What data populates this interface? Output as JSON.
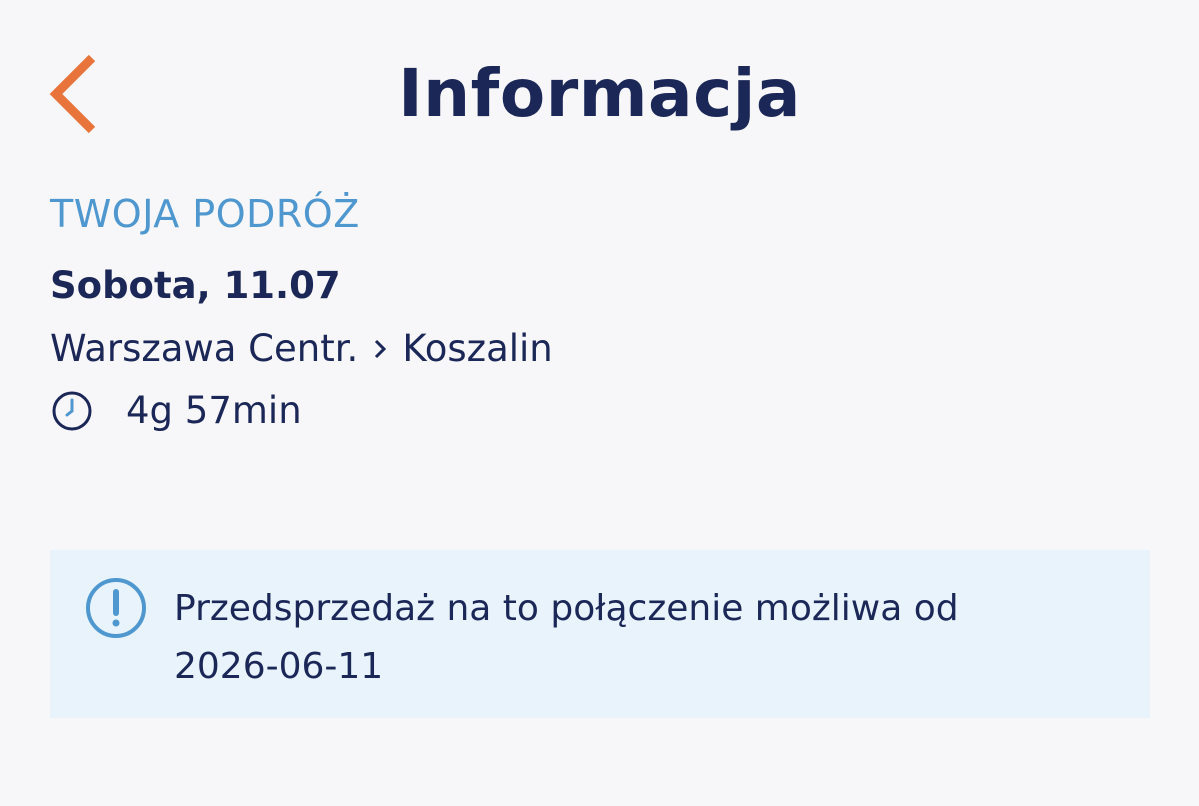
{
  "header": {
    "title": "Informacja"
  },
  "trip": {
    "section_heading": "TWOJA PODRÓŻ",
    "date": "Sobota, 11.07",
    "from": "Warszawa Centr.",
    "to": "Koszalin",
    "duration": "4g 57min"
  },
  "notice": {
    "text_line1": "Przedsprzedaż na to połączenie możliwa od",
    "text_line2": "2026-06-11"
  },
  "icons": {
    "back": "chevron-left-icon",
    "clock": "clock-icon",
    "info": "exclamation-circle-icon",
    "arrow": "chevron-right-icon"
  },
  "colors": {
    "accent_orange": "#e8743b",
    "navy_text": "#1b2757",
    "heading_blue": "#4f97cf",
    "notice_bg": "#e8f3fc",
    "page_bg": "#f7f7f9"
  }
}
